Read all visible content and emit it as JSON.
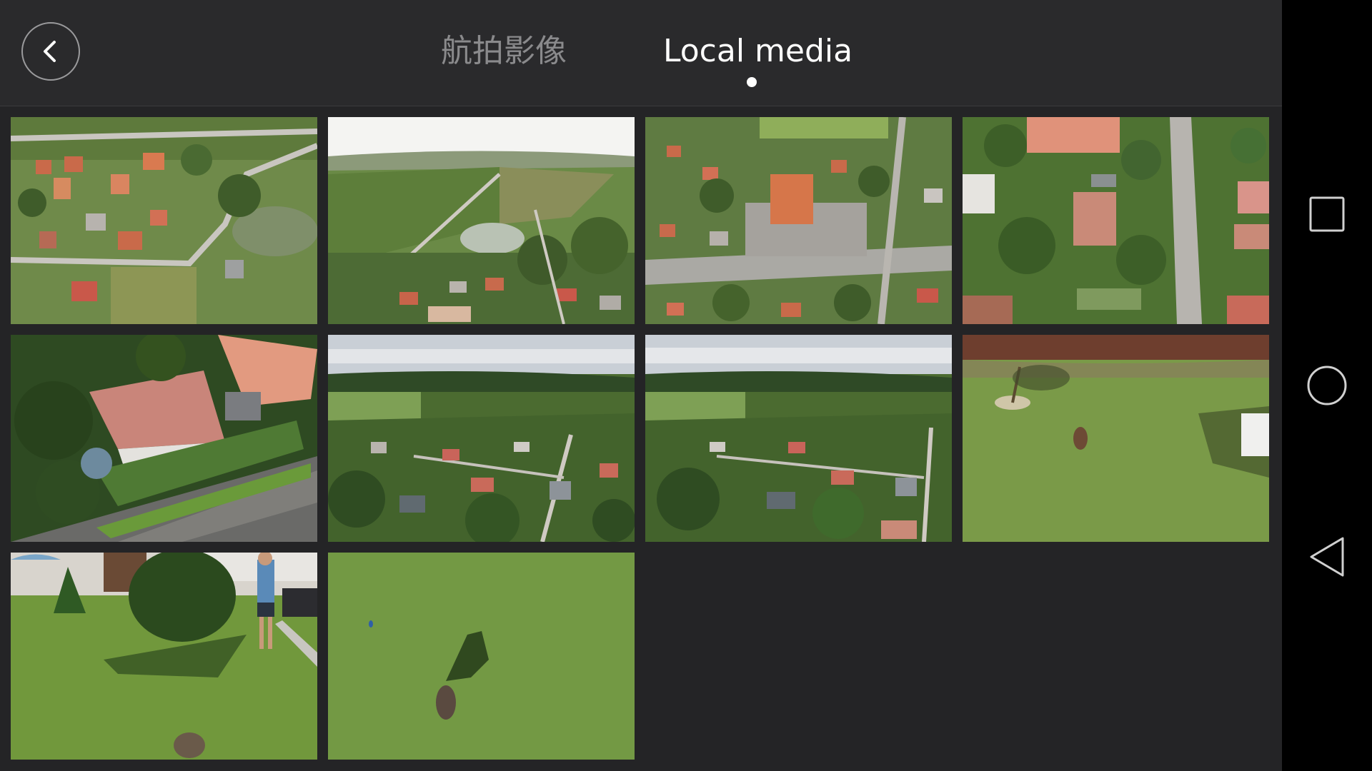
{
  "header": {
    "back_icon": "chevron-left-icon",
    "tabs": [
      {
        "label": "航拍影像",
        "active": false
      },
      {
        "label": "Local media",
        "active": true
      }
    ]
  },
  "media": {
    "items": [
      {
        "kind": "photo",
        "scene": "aerial top-down village with pond"
      },
      {
        "kind": "photo",
        "scene": "aerial fields with road and pond"
      },
      {
        "kind": "photo",
        "scene": "aerial town with orange roof building and parking"
      },
      {
        "kind": "photo",
        "scene": "aerial top-down houses and street"
      },
      {
        "kind": "photo",
        "scene": "aerial house with garden"
      },
      {
        "kind": "photo",
        "scene": "aerial village panorama"
      },
      {
        "kind": "photo",
        "scene": "aerial village panorama"
      },
      {
        "kind": "photo",
        "scene": "lawn with dog from above"
      },
      {
        "kind": "photo",
        "scene": "garden with man and dog"
      },
      {
        "kind": "photo",
        "scene": "grass with dog shadow"
      }
    ]
  },
  "navigation": {
    "recents_icon": "square-icon",
    "home_icon": "circle-icon",
    "back_icon": "triangle-back-icon"
  },
  "colors": {
    "background": "#242426",
    "topbar": "#2a2a2c",
    "active_tab": "#ffffff",
    "inactive_tab": "#8a8a8c"
  }
}
